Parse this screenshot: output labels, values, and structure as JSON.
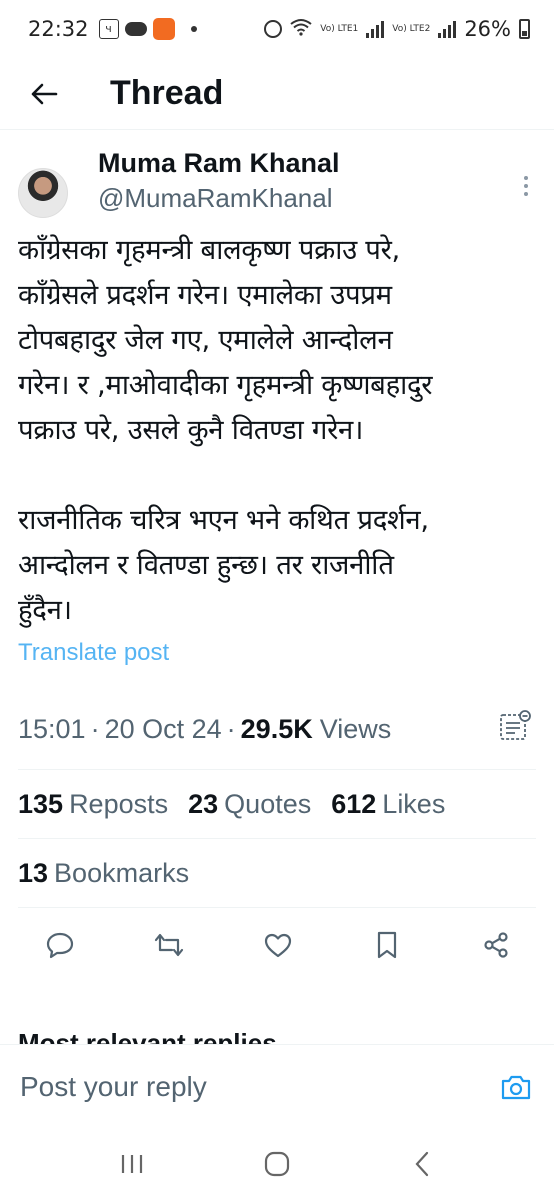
{
  "status_bar": {
    "time": "22:32",
    "battery": "26%",
    "lte1": "Vo) LTE1",
    "lte2": "Vo) LTE2",
    "icons": [
      "notification-icon",
      "cloud-icon",
      "app-icon",
      "alarm-icon",
      "wifi-icon",
      "signal-icon",
      "battery-icon"
    ]
  },
  "header": {
    "title": "Thread",
    "back_icon": "arrow-left-icon"
  },
  "tweet": {
    "author_name": "Muma Ram Khanal",
    "author_handle": "@MumaRamKhanal",
    "body": "काँग्रेसका गृहमन्त्री बालकृष्ण पक्राउ परे,\nकाँग्रेसले प्रदर्शन गरेन। एमालेका उपप्रम\nटोपबहादुर जेल गए, एमालेले आन्दोलन\nगरेन। र ,माओवादीका गृहमन्त्री कृष्णबहादुर\nपक्राउ परे, उसले कुनै वितण्डा गरेन।\n\nराजनीतिक चरित्र भएन भने कथित प्रदर्शन,\nआन्दोलन र वितण्डा हुन्छ। तर राजनीति\nहुँदैन।",
    "translate_label": "Translate post",
    "time": "15:01",
    "date": "20 Oct 24",
    "views_count": "29.5K",
    "views_label": "Views",
    "reposts_count": "135",
    "reposts_label": "Reposts",
    "quotes_count": "23",
    "quotes_label": "Quotes",
    "likes_count": "612",
    "likes_label": "Likes",
    "bookmarks_count": "13",
    "bookmarks_label": "Bookmarks"
  },
  "actions": [
    "reply-icon",
    "repost-icon",
    "like-icon",
    "bookmark-icon",
    "share-icon"
  ],
  "replies_header": "Most relevant replies",
  "reply_bar": {
    "placeholder": "Post your reply"
  },
  "colors": {
    "accent": "#1d9bf0",
    "text_primary": "#0f1419",
    "text_secondary": "#536471",
    "divider": "#eff3f4"
  }
}
